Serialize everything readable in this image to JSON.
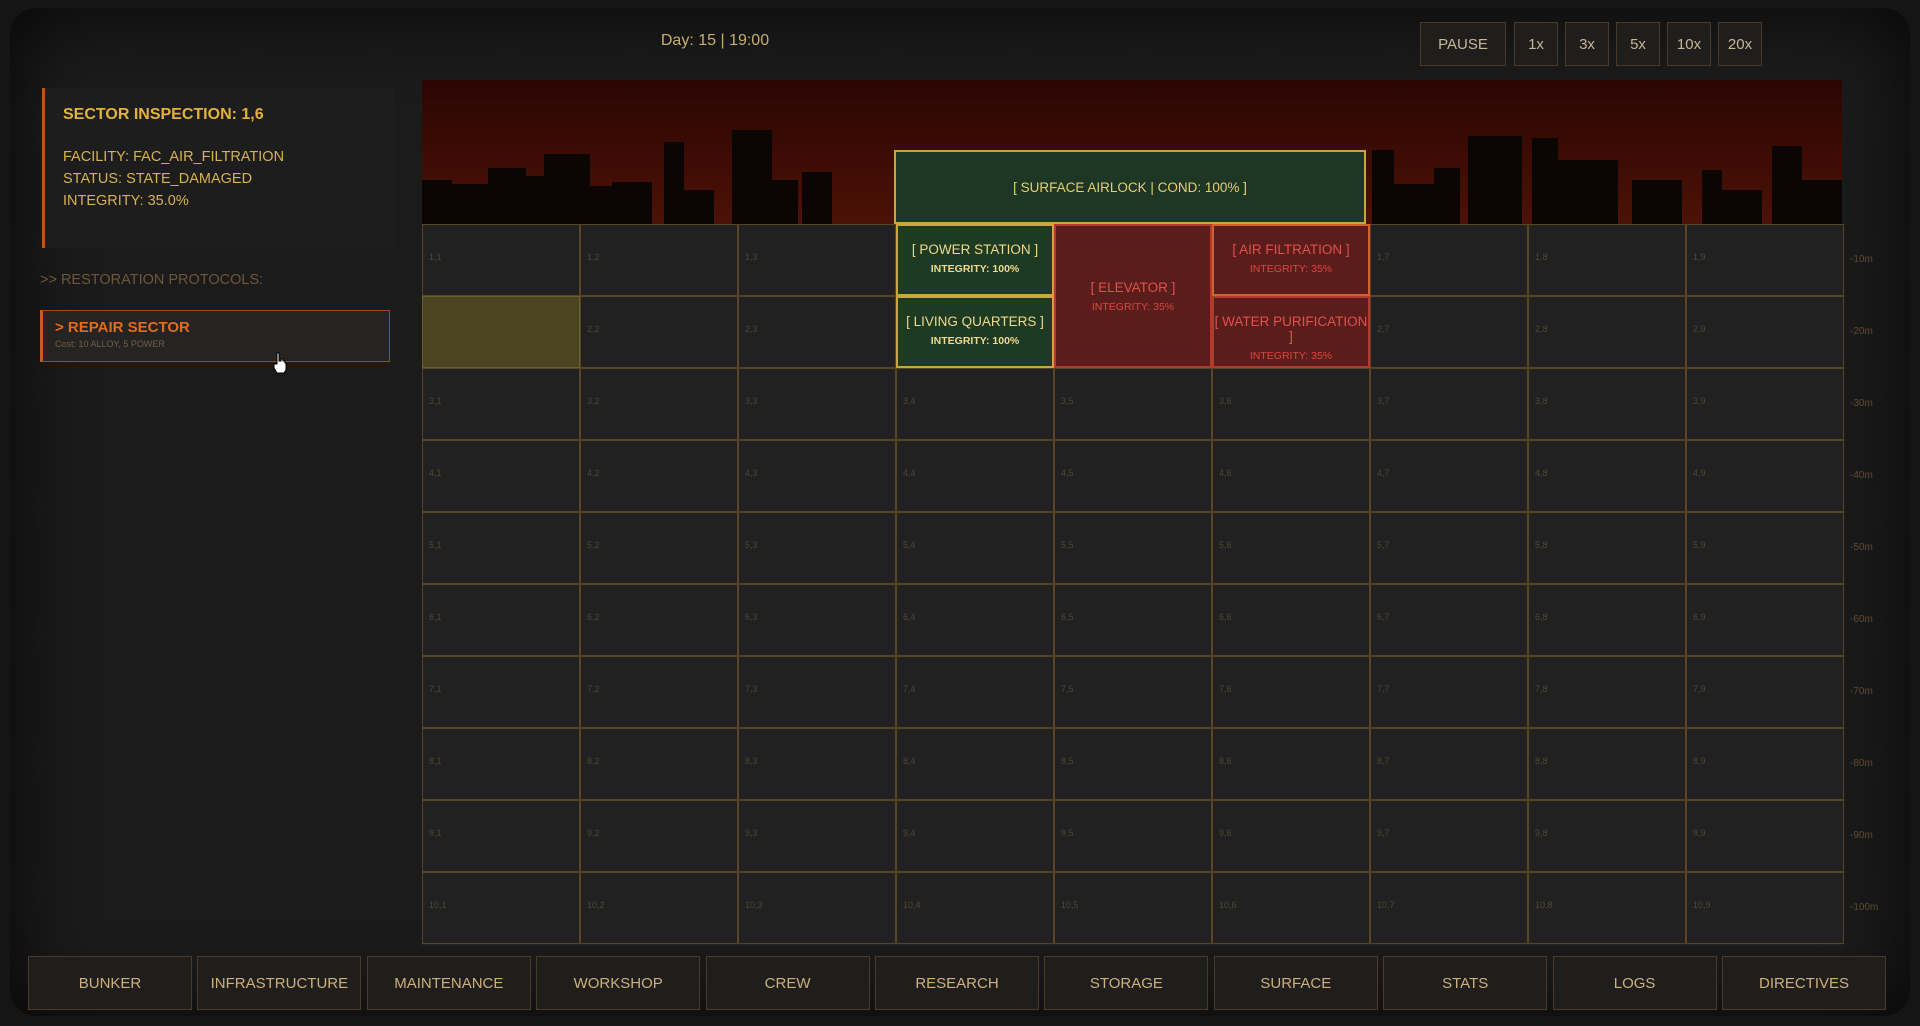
{
  "clock": "Day: 15 | 19:00",
  "speed_controls": [
    "PAUSE",
    "1x",
    "3x",
    "5x",
    "10x",
    "20x"
  ],
  "inspection": {
    "title": "SECTOR INSPECTION: 1,6",
    "facility": "FACILITY: FAC_AIR_FILTRATION",
    "status": "STATUS: STATE_DAMAGED",
    "integrity": "INTEGRITY: 35.0%"
  },
  "protocols_heading": ">> RESTORATION PROTOCOLS:",
  "repair": {
    "label": "> REPAIR SECTOR",
    "cost": "Cost: 10 ALLOY, 5 POWER"
  },
  "airlock": "[ SURFACE AIRLOCK | COND: 100% ]",
  "facilities": [
    {
      "name": "[ POWER STATION ]",
      "integrity": "INTEGRITY: 100%",
      "state": "ok"
    },
    {
      "name": "[ LIVING QUARTERS ]",
      "integrity": "INTEGRITY: 100%",
      "state": "ok"
    },
    {
      "name": "[ ELEVATOR ]",
      "integrity": "INTEGRITY: 35%",
      "state": "bad"
    },
    {
      "name": "[ AIR FILTRATION ]",
      "integrity": "INTEGRITY: 35%",
      "state": "bad-hl"
    },
    {
      "name": "[ WATER PURIFICATION ]",
      "integrity": "INTEGRITY: 35%",
      "state": "bad"
    }
  ],
  "depth_labels": [
    "-10m",
    "-20m",
    "-30m",
    "-40m",
    "-50m",
    "-60m",
    "-70m",
    "-80m",
    "-90m",
    "-100m"
  ],
  "grid": {
    "rows": 10,
    "cols": 9
  },
  "nav": [
    "BUNKER",
    "INFRASTRUCTURE",
    "MAINTENANCE",
    "WORKSHOP",
    "CREW",
    "RESEARCH",
    "STORAGE",
    "SURFACE",
    "STATS",
    "LOGS",
    "DIRECTIVES"
  ],
  "colors": {
    "ok": "#1d3b23",
    "damaged": "#5b1c1c",
    "accent": "#c85d1b",
    "gold": "#c9a63a"
  }
}
